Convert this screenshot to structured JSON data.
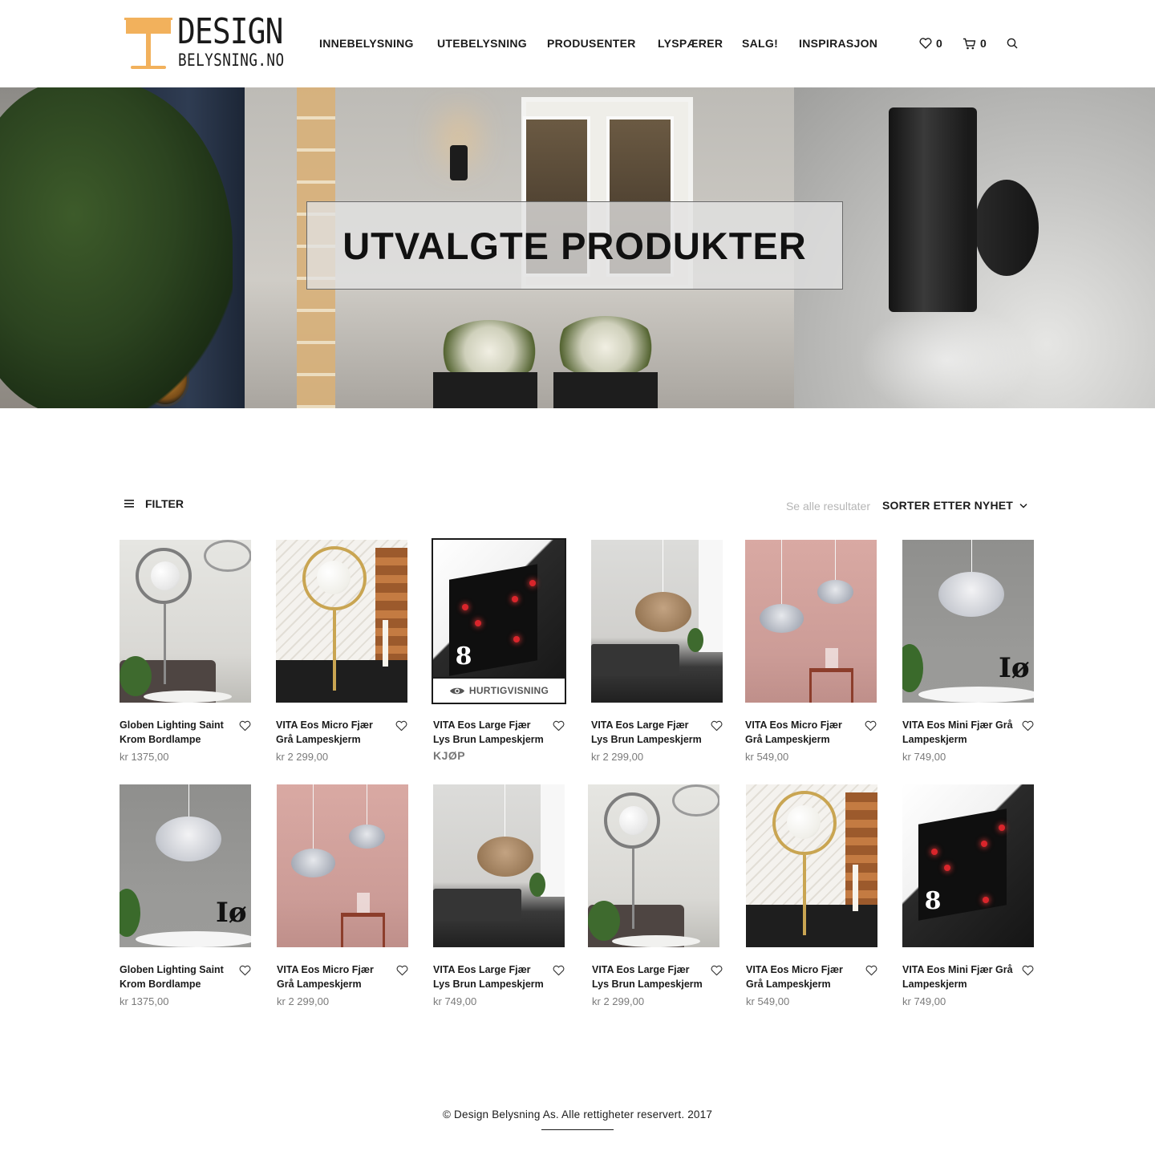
{
  "brand": {
    "logo_top": "DESIGN",
    "logo_bottom": "BELYSNING.NO",
    "accent_color": "#f2b15c"
  },
  "nav": {
    "items": [
      {
        "label": "INNEBELYSNING"
      },
      {
        "label": "UTEBELYSNING"
      },
      {
        "label": "PRODUSENTER"
      },
      {
        "label": "LYSPÆRER"
      },
      {
        "label": "SALG!"
      },
      {
        "label": "INSPIRASJON"
      }
    ]
  },
  "header": {
    "wishlist_icon": "heart-icon",
    "wishlist_count": "0",
    "cart_icon": "cart-icon",
    "cart_count": "0",
    "search_icon": "search-icon"
  },
  "hero": {
    "title": "UTVALGTE PRODUKTER"
  },
  "toolbar": {
    "filter_icon": "menu-lines-icon",
    "filter_label": "FILTER",
    "see_all_label": "Se alle resultater",
    "sort_label": "SORTER ETTER NYHET",
    "sort_icon": "chevron-down-icon"
  },
  "quickview_label": "HURTIGVISNING",
  "buy_label": "KJØP",
  "products": [
    {
      "name": "Globen Lighting Saint Krom Bordlampe",
      "price": "kr 1375,00",
      "image": "globen-chrome"
    },
    {
      "name": "VITA Eos Micro Fjær Grå Lampeskjerm",
      "price": "kr 2 299,00",
      "image": "micro-gold"
    },
    {
      "name": "VITA Eos Large Fjær Lys Brun Lampeskjerm",
      "price": "",
      "image": "hearts",
      "hovered": true
    },
    {
      "name": "VITA Eos Large Fjær Lys Brun Lampeskjerm",
      "price": "kr 2 299,00",
      "image": "large-brown"
    },
    {
      "name": "VITA Eos Micro Fjær Grå Lampeskjerm",
      "price": "kr 549,00",
      "image": "micro-pink"
    },
    {
      "name": "VITA Eos Mini Fjær Grå Lampeskjerm",
      "price": "kr 749,00",
      "image": "mini-grey"
    },
    {
      "name": "Globen Lighting Saint Krom Bordlampe",
      "price": "kr 1375,00",
      "image": "mini-grey"
    },
    {
      "name": "VITA Eos Micro Fjær Grå Lampeskjerm",
      "price": "kr 2 299,00",
      "image": "micro-pink"
    },
    {
      "name": "VITA Eos Large Fjær Lys Brun Lampeskjerm",
      "price": "kr 749,00",
      "image": "large-brown"
    },
    {
      "name": "VITA Eos Large Fjær Lys Brun Lampeskjerm",
      "price": "kr 2 299,00",
      "image": "globen-chrome"
    },
    {
      "name": "VITA Eos Micro Fjær Grå Lampeskjerm",
      "price": "kr 549,00",
      "image": "micro-gold"
    },
    {
      "name": "VITA Eos Mini Fjær Grå Lampeskjerm",
      "price": "kr 749,00",
      "image": "hearts"
    }
  ],
  "footer": {
    "copyright": "© Design Belysning As. Alle rettigheter reservert. 2017"
  }
}
